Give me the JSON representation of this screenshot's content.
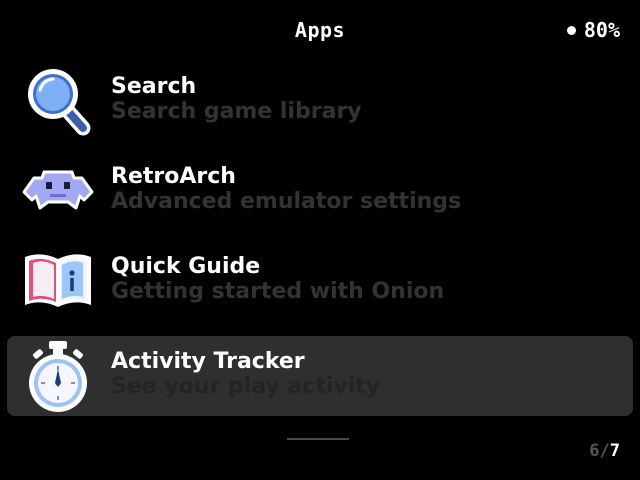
{
  "header": {
    "title": "Apps",
    "battery_text": "80%"
  },
  "items": [
    {
      "title": "Search",
      "subtitle": "Search game library",
      "icon": "magnifier-icon"
    },
    {
      "title": "RetroArch",
      "subtitle": "Advanced emulator settings",
      "icon": "retroarch-space-invader-icon"
    },
    {
      "title": "Quick Guide",
      "subtitle": "Getting started with Onion",
      "icon": "book-icon"
    },
    {
      "title": "Activity Tracker",
      "subtitle": "See your play activity",
      "icon": "stopwatch-icon",
      "selected": true
    }
  ],
  "pagination": {
    "current": "6",
    "separator": "/",
    "total": "7"
  },
  "colors": {
    "background": "#000000",
    "selected_row": "#2f2f2f",
    "subtitle": "#333333",
    "icon_blue": "#8ab4f8",
    "icon_purple": "#9fa3f0",
    "icon_book_red": "#e0507a"
  }
}
